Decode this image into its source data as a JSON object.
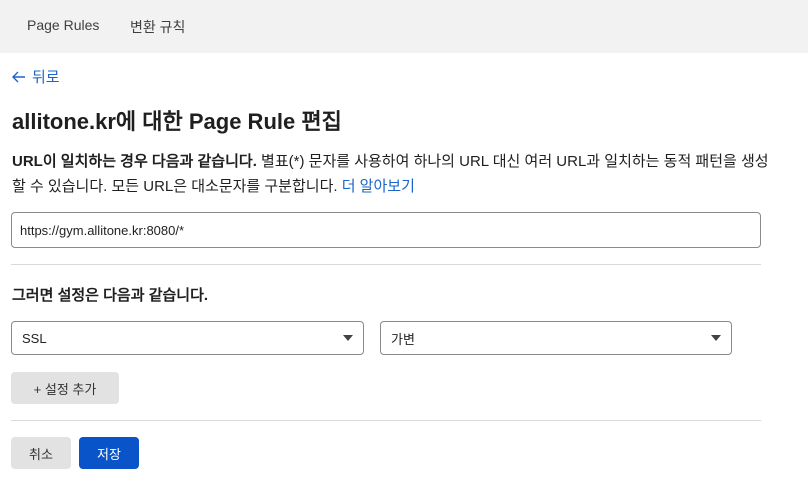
{
  "tabs": [
    {
      "label": "Page Rules"
    },
    {
      "label": "변환 규칙"
    }
  ],
  "back_label": "뒤로",
  "page_title": "allitone.kr에 대한 Page Rule 편집",
  "description": {
    "bold": "URL이 일치하는 경우 다음과 같습니다.",
    "text": " 별표(*) 문자를 사용하여 하나의 URL 대신 여러 URL과 일치하는 동적 패턴을 생성할 수 있습니다. 모든 URL은 대소문자를 구분합니다. ",
    "link": "더 알아보기"
  },
  "url_input": {
    "value": "https://gym.allitone.kr:8080/*"
  },
  "settings_title": "그러면 설정은 다음과 같습니다.",
  "setting": {
    "name": "SSL",
    "value": "가변"
  },
  "add_setting_label": "+ 설정 추가",
  "cancel_label": "취소",
  "save_label": "저장",
  "colors": {
    "link": "#1b65c9",
    "primary": "#0a54c9",
    "topbar": "#f2f2f2"
  }
}
